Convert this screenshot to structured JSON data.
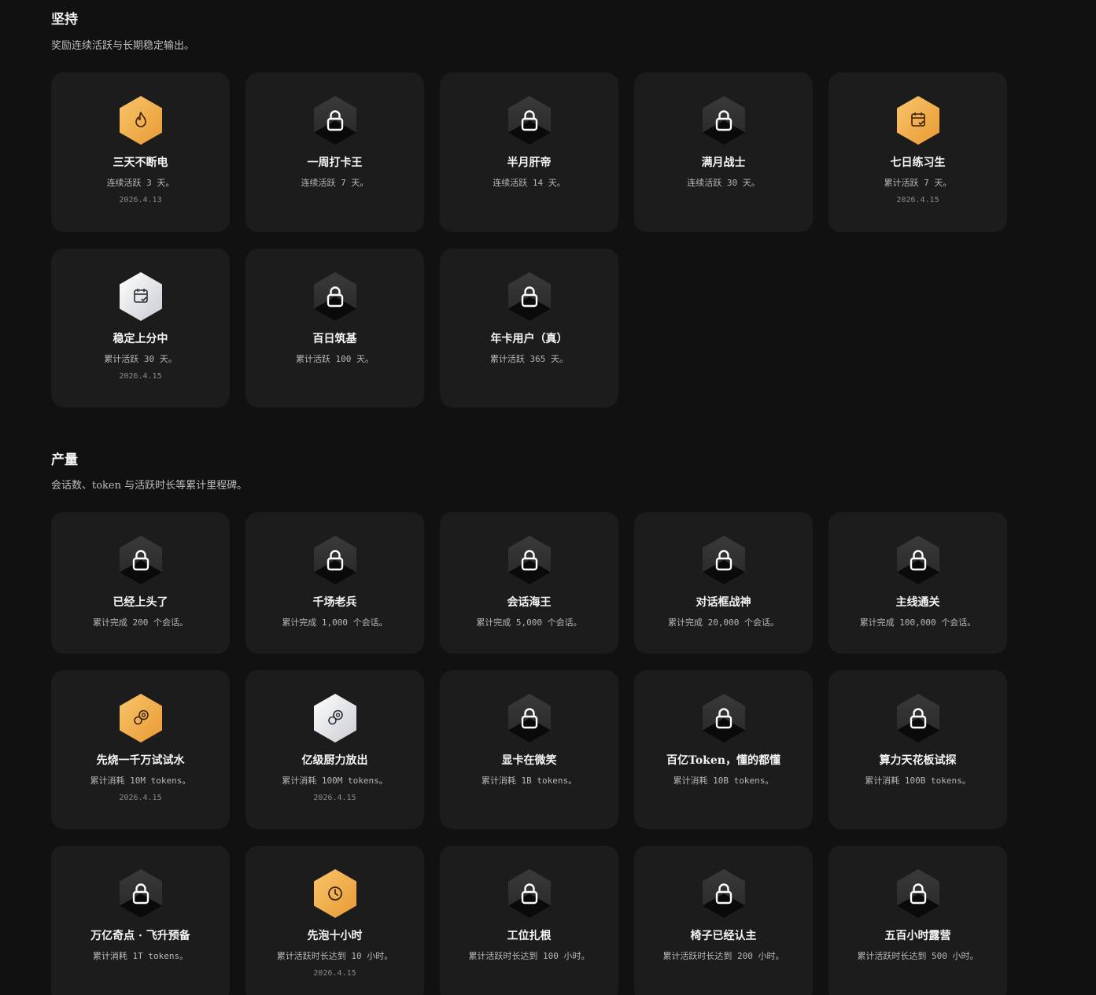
{
  "sections": [
    {
      "title": "坚持",
      "desc": "奖励连续活跃与长期稳定输出。",
      "cards": [
        {
          "title": "三天不断电",
          "desc": "连续活跃 3 天。",
          "date": "2026.4.13",
          "badge": "gold",
          "icon": "flame-icon"
        },
        {
          "title": "一周打卡王",
          "desc": "连续活跃 7 天。",
          "date": "",
          "badge": "locked",
          "icon": "lock-icon"
        },
        {
          "title": "半月肝帝",
          "desc": "连续活跃 14 天。",
          "date": "",
          "badge": "locked",
          "icon": "lock-icon"
        },
        {
          "title": "满月战士",
          "desc": "连续活跃 30 天。",
          "date": "",
          "badge": "locked",
          "icon": "lock-icon"
        },
        {
          "title": "七日练习生",
          "desc": "累计活跃 7 天。",
          "date": "2026.4.15",
          "badge": "gold",
          "icon": "calendar-check-icon"
        },
        {
          "title": "稳定上分中",
          "desc": "累计活跃 30 天。",
          "date": "2026.4.15",
          "badge": "silver",
          "icon": "calendar-check-icon"
        },
        {
          "title": "百日筑基",
          "desc": "累计活跃 100 天。",
          "date": "",
          "badge": "locked",
          "icon": "lock-icon"
        },
        {
          "title": "年卡用户（真）",
          "desc": "累计活跃 365 天。",
          "date": "",
          "badge": "locked",
          "icon": "lock-icon"
        }
      ]
    },
    {
      "title": "产量",
      "desc": "会话数、token 与活跃时长等累计里程碑。",
      "cards": [
        {
          "title": "已经上头了",
          "desc": "累计完成 200 个会话。",
          "date": "",
          "badge": "locked",
          "icon": "lock-icon"
        },
        {
          "title": "千场老兵",
          "desc": "累计完成 1,000 个会话。",
          "date": "",
          "badge": "locked",
          "icon": "lock-icon"
        },
        {
          "title": "会话海王",
          "desc": "累计完成 5,000 个会话。",
          "date": "",
          "badge": "locked",
          "icon": "lock-icon"
        },
        {
          "title": "对话框战神",
          "desc": "累计完成 20,000 个会话。",
          "date": "",
          "badge": "locked",
          "icon": "lock-icon"
        },
        {
          "title": "主线通关",
          "desc": "累计完成 100,000 个会话。",
          "date": "",
          "badge": "locked",
          "icon": "lock-icon"
        },
        {
          "title": "先烧一千万试试水",
          "desc": "累计消耗 10M tokens。",
          "date": "2026.4.15",
          "badge": "gold",
          "icon": "coins-icon"
        },
        {
          "title": "亿级厨力放出",
          "desc": "累计消耗 100M tokens。",
          "date": "2026.4.15",
          "badge": "silver",
          "icon": "coins-icon"
        },
        {
          "title": "显卡在微笑",
          "desc": "累计消耗 1B tokens。",
          "date": "",
          "badge": "locked",
          "icon": "lock-icon"
        },
        {
          "title": "百亿Token，懂的都懂",
          "desc": "累计消耗 10B tokens。",
          "date": "",
          "badge": "locked",
          "icon": "lock-icon"
        },
        {
          "title": "算力天花板试探",
          "desc": "累计消耗 100B tokens。",
          "date": "",
          "badge": "locked",
          "icon": "lock-icon"
        },
        {
          "title": "万亿奇点 · 飞升预备",
          "desc": "累计消耗 1T tokens。",
          "date": "",
          "badge": "locked",
          "icon": "lock-icon"
        },
        {
          "title": "先泡十小时",
          "desc": "累计活跃时长达到 10 小时。",
          "date": "2026.4.15",
          "badge": "gold",
          "icon": "clock-icon"
        },
        {
          "title": "工位扎根",
          "desc": "累计活跃时长达到 100 小时。",
          "date": "",
          "badge": "locked",
          "icon": "lock-icon"
        },
        {
          "title": "椅子已经认主",
          "desc": "累计活跃时长达到 200 小时。",
          "date": "",
          "badge": "locked",
          "icon": "lock-icon"
        },
        {
          "title": "五百小时露营",
          "desc": "累计活跃时长达到 500 小时。",
          "date": "",
          "badge": "locked",
          "icon": "lock-icon"
        }
      ]
    }
  ]
}
